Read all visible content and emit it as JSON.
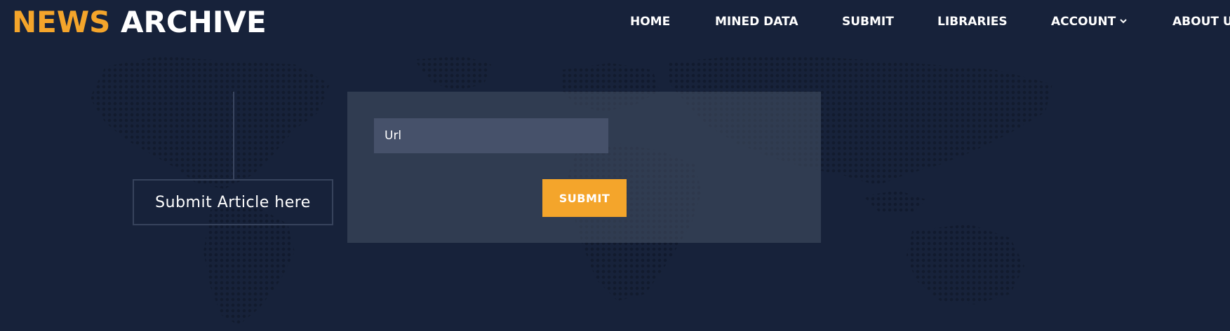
{
  "logo": {
    "accent_text": "NEWS",
    "main_text": " ARCHIVE"
  },
  "nav": {
    "items": [
      {
        "label": "HOME"
      },
      {
        "label": "MINED DATA"
      },
      {
        "label": "SUBMIT"
      },
      {
        "label": "LIBRARIES"
      },
      {
        "label": "ACCOUNT",
        "icon": "chevron-down-icon"
      },
      {
        "label": "ABOUT US"
      }
    ]
  },
  "callout": {
    "label": "Submit Article here"
  },
  "form": {
    "url_placeholder": "Url",
    "url_value": "",
    "submit_label": "SUBMIT"
  },
  "colors": {
    "background": "#17223a",
    "accent": "#f4a52b",
    "panel": "#2c3749",
    "input": "#46516a",
    "text": "#ffffff"
  }
}
